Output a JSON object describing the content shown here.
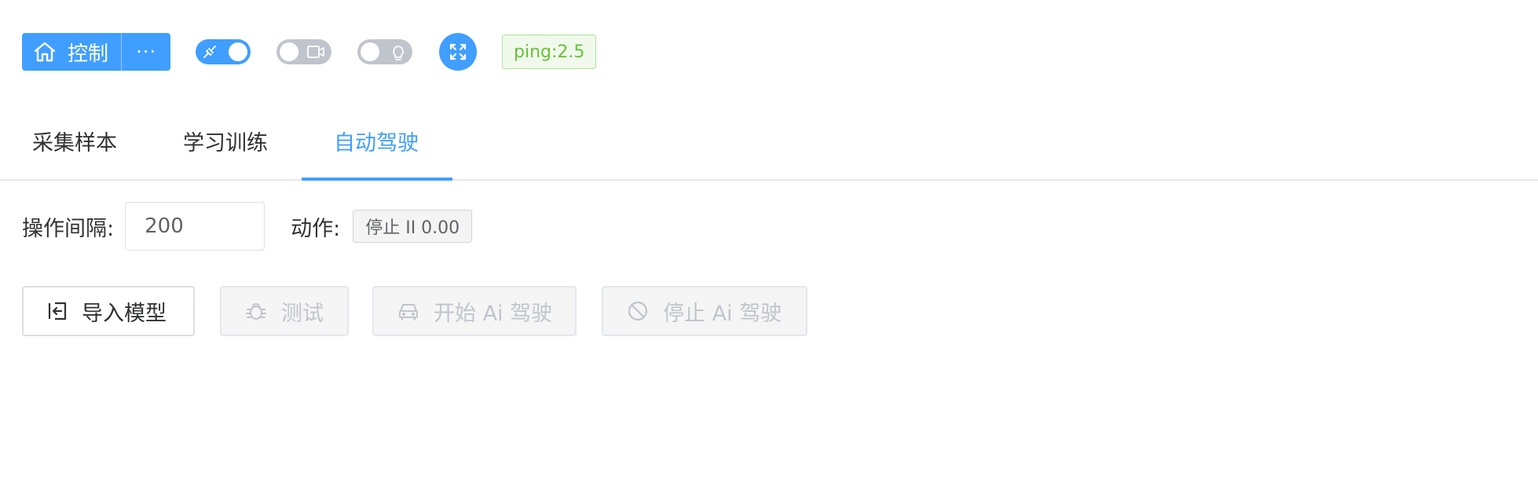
{
  "toolbar": {
    "control_label": "控制",
    "more_label": "···",
    "ping": "ping:2.5"
  },
  "switches": {
    "connect": {
      "state": "on",
      "icon": "plug-icon"
    },
    "camera": {
      "state": "off",
      "icon": "camera-icon"
    },
    "light": {
      "state": "off",
      "icon": "bulb-icon"
    }
  },
  "tabs": [
    {
      "label": "采集样本"
    },
    {
      "label": "学习训练"
    },
    {
      "label": "自动驾驶",
      "active": true
    }
  ],
  "form": {
    "interval_label": "操作间隔:",
    "interval_value": "200",
    "action_label": "动作:",
    "action_value": "停止 II 0.00"
  },
  "buttons": {
    "import": "导入模型",
    "test": "测试",
    "start": "开始 Ai 驾驶",
    "stop": "停止 Ai 驾驶"
  },
  "colors": {
    "primary": "#409eff",
    "success": "#67c23a",
    "disabled_text": "#c0c4cc"
  }
}
